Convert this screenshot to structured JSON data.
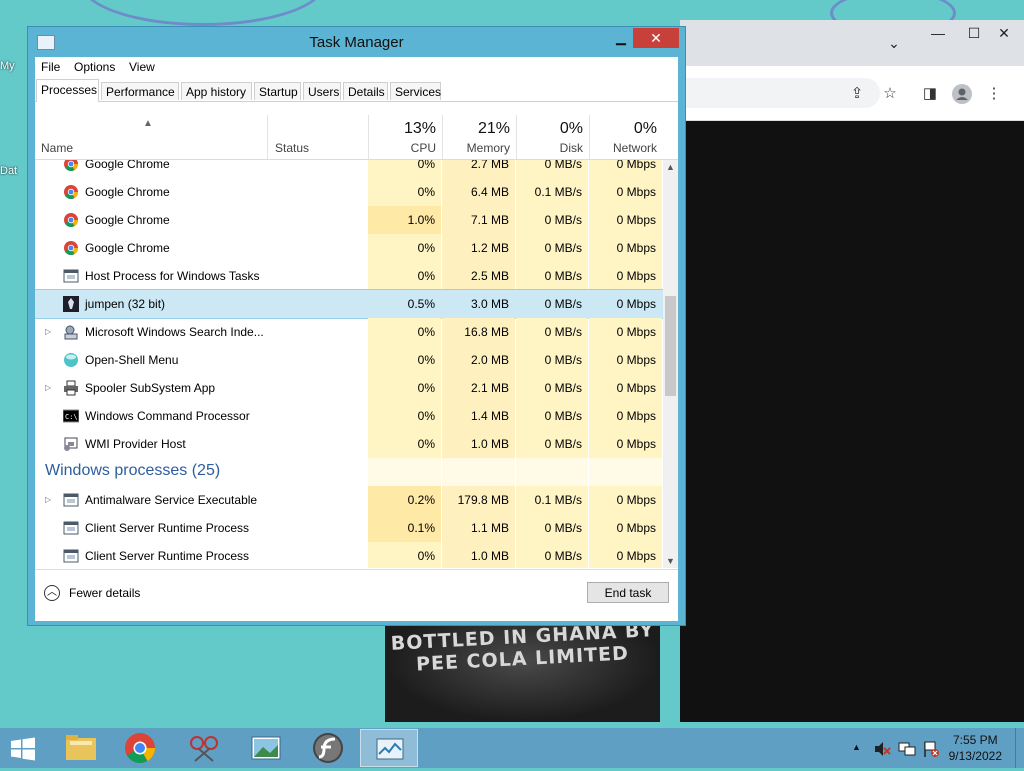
{
  "desktop": {
    "label_top": "My",
    "label_mid": "Dat"
  },
  "chrome": {
    "minimize": "—",
    "maximize": "☐",
    "close": "✕",
    "chevron": "⌄",
    "bottle_line1": "BOTTLED IN GHANA BY",
    "bottle_line2": "PEE COLA LIMITED"
  },
  "task_manager": {
    "title": "Task Manager",
    "menu": [
      "File",
      "Options",
      "View"
    ],
    "tabs": [
      "Processes",
      "Performance",
      "App history",
      "Startup",
      "Users",
      "Details",
      "Services"
    ],
    "columns": {
      "name": "Name",
      "status": "Status",
      "cpu": {
        "pct": "13%",
        "label": "CPU"
      },
      "memory": {
        "pct": "21%",
        "label": "Memory"
      },
      "disk": {
        "pct": "0%",
        "label": "Disk"
      },
      "network": {
        "pct": "0%",
        "label": "Network"
      }
    },
    "rows": [
      {
        "kind": "process",
        "name": "Google Chrome",
        "icon": "chrome",
        "expand": false,
        "cpu": "0%",
        "memory": "2.7 MB",
        "disk": "0 MB/s",
        "network": "0 Mbps",
        "cpu_hi": false
      },
      {
        "kind": "process",
        "name": "Google Chrome",
        "icon": "chrome",
        "expand": false,
        "cpu": "0%",
        "memory": "6.4 MB",
        "disk": "0.1 MB/s",
        "network": "0 Mbps",
        "cpu_hi": false
      },
      {
        "kind": "process",
        "name": "Google Chrome",
        "icon": "chrome",
        "expand": false,
        "cpu": "1.0%",
        "memory": "7.1 MB",
        "disk": "0 MB/s",
        "network": "0 Mbps",
        "cpu_hi": true
      },
      {
        "kind": "process",
        "name": "Google Chrome",
        "icon": "chrome",
        "expand": false,
        "cpu": "0%",
        "memory": "1.2 MB",
        "disk": "0 MB/s",
        "network": "0 Mbps",
        "cpu_hi": false
      },
      {
        "kind": "process",
        "name": "Host Process for Windows Tasks",
        "icon": "window",
        "expand": false,
        "cpu": "0%",
        "memory": "2.5 MB",
        "disk": "0 MB/s",
        "network": "0 Mbps",
        "cpu_hi": false
      },
      {
        "kind": "process",
        "name": "jumpen (32 bit)",
        "icon": "jumpen",
        "expand": false,
        "selected": true,
        "cpu": "0.5%",
        "memory": "3.0 MB",
        "disk": "0 MB/s",
        "network": "0 Mbps",
        "cpu_hi": false
      },
      {
        "kind": "process",
        "name": "Microsoft Windows Search Inde...",
        "icon": "search",
        "expand": true,
        "cpu": "0%",
        "memory": "16.8 MB",
        "disk": "0 MB/s",
        "network": "0 Mbps",
        "cpu_hi": false
      },
      {
        "kind": "process",
        "name": "Open-Shell Menu",
        "icon": "shell",
        "expand": false,
        "cpu": "0%",
        "memory": "2.0 MB",
        "disk": "0 MB/s",
        "network": "0 Mbps",
        "cpu_hi": false
      },
      {
        "kind": "process",
        "name": "Spooler SubSystem App",
        "icon": "printer",
        "expand": true,
        "cpu": "0%",
        "memory": "2.1 MB",
        "disk": "0 MB/s",
        "network": "0 Mbps",
        "cpu_hi": false
      },
      {
        "kind": "process",
        "name": "Windows Command Processor",
        "icon": "cmd",
        "expand": false,
        "cpu": "0%",
        "memory": "1.4 MB",
        "disk": "0 MB/s",
        "network": "0 Mbps",
        "cpu_hi": false
      },
      {
        "kind": "process",
        "name": "WMI Provider Host",
        "icon": "wmi",
        "expand": false,
        "cpu": "0%",
        "memory": "1.0 MB",
        "disk": "0 MB/s",
        "network": "0 Mbps",
        "cpu_hi": false
      },
      {
        "kind": "group",
        "name": "Windows processes (25)"
      },
      {
        "kind": "process",
        "name": "Antimalware Service Executable",
        "icon": "window",
        "expand": true,
        "cpu": "0.2%",
        "memory": "179.8 MB",
        "disk": "0.1 MB/s",
        "network": "0 Mbps",
        "cpu_hi": true
      },
      {
        "kind": "process",
        "name": "Client Server Runtime Process",
        "icon": "window",
        "expand": false,
        "cpu": "0.1%",
        "memory": "1.1 MB",
        "disk": "0 MB/s",
        "network": "0 Mbps",
        "cpu_hi": true
      },
      {
        "kind": "process",
        "name": "Client Server Runtime Process",
        "icon": "window",
        "expand": false,
        "cpu": "0%",
        "memory": "1.0 MB",
        "disk": "0 MB/s",
        "network": "0 Mbps",
        "cpu_hi": false
      }
    ],
    "fewer_details": "Fewer details",
    "end_task": "End task"
  },
  "taskbar": {
    "apps": [
      "file-explorer",
      "google-chrome",
      "snipping-tool",
      "photo-viewer",
      "flash-player",
      "task-manager"
    ],
    "clock_time": "7:55 PM",
    "clock_date": "9/13/2022",
    "tray_arrow": "▲"
  },
  "colors": {
    "cpu_bg": "#fff4c4",
    "cpu_hi_bg": "#ffe9a6",
    "selected_bg": "#cce8f4",
    "group_title": "#2c5d9e",
    "close_red": "#c7413a"
  }
}
